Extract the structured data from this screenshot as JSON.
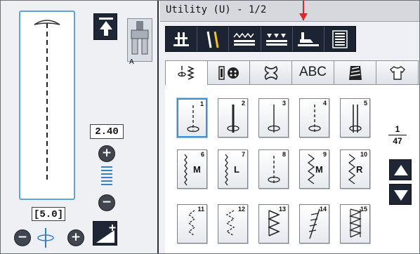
{
  "header": {
    "title": "Utility (U) - 1/2"
  },
  "left_panel": {
    "stitch_length": "2.40",
    "stitch_width": "[5.0]",
    "presser_foot": {
      "label": "A",
      "icon": "presser-foot-a-icon"
    },
    "plus_symbol": "+",
    "minus_symbol": "−"
  },
  "toolbar": {
    "items": [
      {
        "icon": "needle-position-icon"
      },
      {
        "icon": "twin-needle-icon"
      },
      {
        "icon": "stitch-elongation-icon"
      },
      {
        "icon": "mirror-stitch-icon"
      },
      {
        "icon": "presser-foot-pressure-icon"
      },
      {
        "icon": "stitch-chart-icon"
      }
    ]
  },
  "tabs": [
    {
      "icon": "utility-stitch-icon",
      "label": "",
      "active": true
    },
    {
      "icon": "buttonhole-icon",
      "label": ""
    },
    {
      "icon": "decorative-stitch-icon",
      "label": ""
    },
    {
      "icon": "",
      "label": "ABC"
    },
    {
      "icon": "quilting-stitch-icon",
      "label": ""
    },
    {
      "icon": "garment-icon",
      "label": ""
    }
  ],
  "stitches": [
    {
      "num": "1",
      "letter": "",
      "selected": true
    },
    {
      "num": "2",
      "letter": ""
    },
    {
      "num": "3",
      "letter": ""
    },
    {
      "num": "4",
      "letter": ""
    },
    {
      "num": "5",
      "letter": ""
    },
    {
      "num": "6",
      "letter": "M"
    },
    {
      "num": "7",
      "letter": "L"
    },
    {
      "num": "8",
      "letter": ""
    },
    {
      "num": "9",
      "letter": "M"
    },
    {
      "num": "10",
      "letter": "R"
    },
    {
      "num": "11",
      "letter": ""
    },
    {
      "num": "12",
      "letter": ""
    },
    {
      "num": "13",
      "letter": ""
    },
    {
      "num": "14",
      "letter": ""
    },
    {
      "num": "15",
      "letter": ""
    }
  ],
  "pagination": {
    "current": "1",
    "total": "47"
  },
  "colors": {
    "accent": "#3f8fd4",
    "dark_button": "#1f2736",
    "marker": "#e3232b"
  }
}
